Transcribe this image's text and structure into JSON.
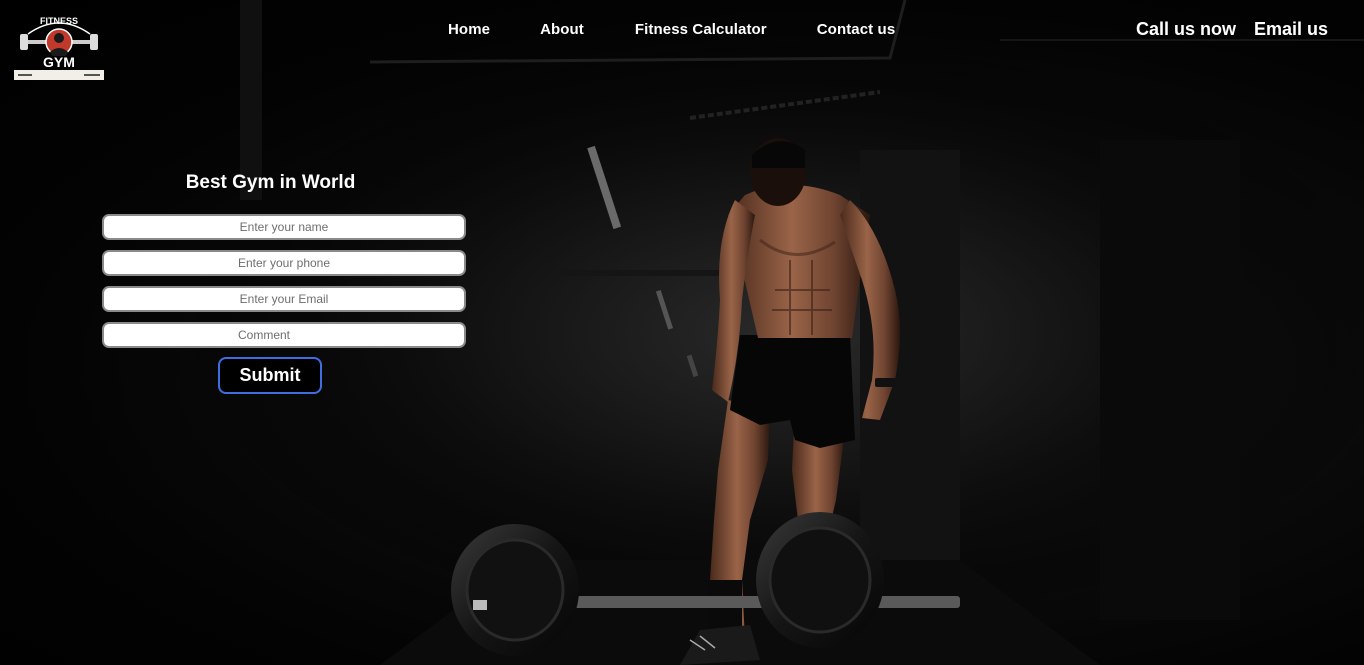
{
  "brand": {
    "logo_text_top": "FITNESS",
    "logo_text_main": "GYM"
  },
  "nav": {
    "items": [
      {
        "label": "Home"
      },
      {
        "label": "About"
      },
      {
        "label": "Fitness Calculator"
      },
      {
        "label": "Contact us"
      }
    ]
  },
  "contact": {
    "call_label": "Call us now",
    "email_label": "Email us"
  },
  "form": {
    "title": "Best Gym in World",
    "name_placeholder": "Enter your name",
    "phone_placeholder": "Enter your phone",
    "email_placeholder": "Enter your Email",
    "comment_placeholder": "Comment",
    "submit_label": "Submit"
  },
  "colors": {
    "background": "#000000",
    "text": "#ffffff",
    "submit_border": "#3f6ee0",
    "field_border": "#8a8a8a"
  }
}
